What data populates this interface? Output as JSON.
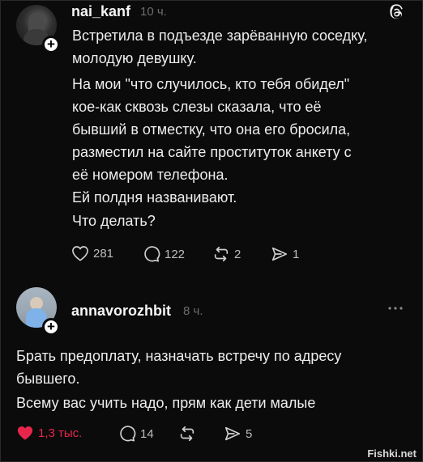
{
  "post": {
    "username": "nai_kanf",
    "time": "10 ч.",
    "lines": [
      "Встретила в подъезде зарёванную соседку,",
      "молодую девушку.",
      "На мои \"что случилось, кто тебя обидел\"",
      "кое-как сквозь слезы сказала, что её",
      "бывший в отместку, что она его бросила,",
      "разместил на сайте проституток анкету с",
      "её номером телефона.",
      "Ей полдня названивают.",
      "Что делать?"
    ],
    "likes": "281",
    "comments": "122",
    "reposts": "2",
    "shares": "1"
  },
  "reply": {
    "username": "annavorozhbit",
    "time": "8 ч.",
    "lines": [
      "Брать предоплату, назначать встречу по адресу",
      "бывшего.",
      "Всему вас учить надо, прям как дети малые"
    ],
    "likes": "1,3 тыс.",
    "comments": "14",
    "shares": "5"
  },
  "watermark": "Fishki.net",
  "icons": {
    "threads": "threads-logo-icon",
    "more": "more-options-icon",
    "heart": "heart-icon",
    "comment": "comment-icon",
    "repost": "repost-icon",
    "share": "share-icon"
  },
  "colors": {
    "background": "#0b0b0b",
    "text": "#ededed",
    "muted": "#6d6d6d",
    "like_active": "#e8264b"
  }
}
